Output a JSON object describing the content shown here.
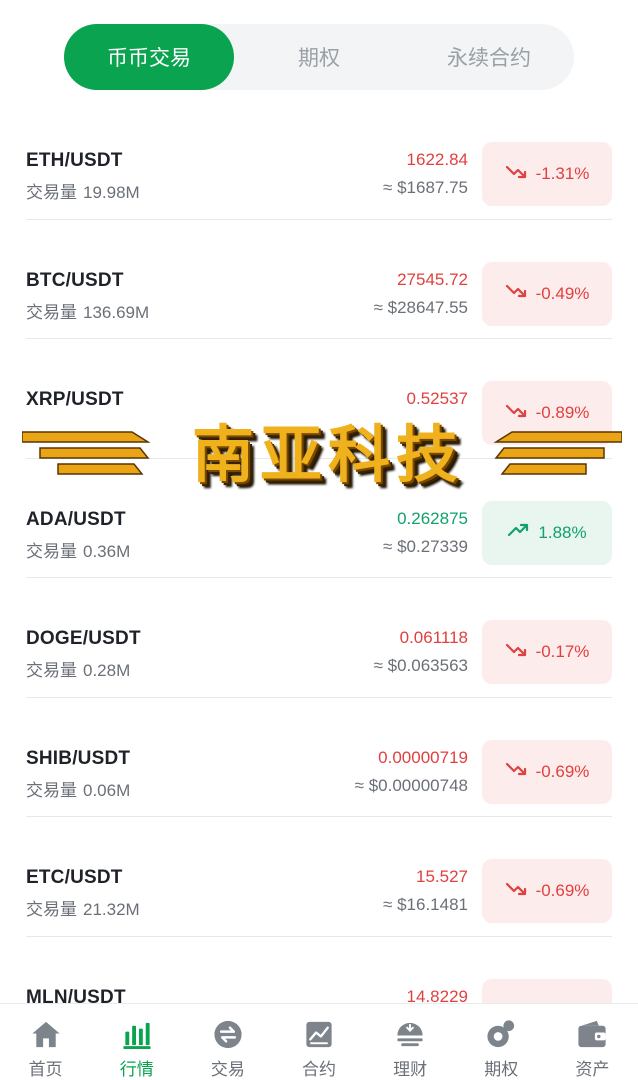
{
  "tabs": [
    {
      "label": "币币交易"
    },
    {
      "label": "期权"
    },
    {
      "label": "永续合约"
    }
  ],
  "volume_label": "交易量",
  "rows": [
    {
      "pair": "ETH/USDT",
      "volume": "19.98M",
      "price": "1622.84",
      "fiat": "≈ $1687.75",
      "change": "-1.31%",
      "dir": "down"
    },
    {
      "pair": "BTC/USDT",
      "volume": "136.69M",
      "price": "27545.72",
      "fiat": "≈ $28647.55",
      "change": "-0.49%",
      "dir": "down"
    },
    {
      "pair": "XRP/USDT",
      "volume": "",
      "price": "0.52537",
      "fiat": "",
      "change": "-0.89%",
      "dir": "down"
    },
    {
      "pair": "ADA/USDT",
      "volume": "0.36M",
      "price": "0.262875",
      "fiat": "≈ $0.27339",
      "change": "1.88%",
      "dir": "up"
    },
    {
      "pair": "DOGE/USDT",
      "volume": "0.28M",
      "price": "0.061118",
      "fiat": "≈ $0.063563",
      "change": "-0.17%",
      "dir": "down"
    },
    {
      "pair": "SHIB/USDT",
      "volume": "0.06M",
      "price": "0.00000719",
      "fiat": "≈ $0.00000748",
      "change": "-0.69%",
      "dir": "down"
    },
    {
      "pair": "ETC/USDT",
      "volume": "21.32M",
      "price": "15.527",
      "fiat": "≈ $16.1481",
      "change": "-0.69%",
      "dir": "down"
    },
    {
      "pair": "MLN/USDT",
      "volume": "",
      "price": "14.8229",
      "fiat": "",
      "change": "",
      "dir": "down"
    }
  ],
  "watermark": "南亚科技",
  "nav": [
    {
      "label": "首页",
      "icon": "home-icon"
    },
    {
      "label": "行情",
      "icon": "market-bars-icon"
    },
    {
      "label": "交易",
      "icon": "exchange-icon"
    },
    {
      "label": "合约",
      "icon": "contract-chart-icon"
    },
    {
      "label": "理财",
      "icon": "finance-icon"
    },
    {
      "label": "期权",
      "icon": "options-icon"
    },
    {
      "label": "资产",
      "icon": "wallet-icon"
    }
  ],
  "colors": {
    "accent": "#0aa34f",
    "down": "#e0413f",
    "up": "#12a06b"
  }
}
